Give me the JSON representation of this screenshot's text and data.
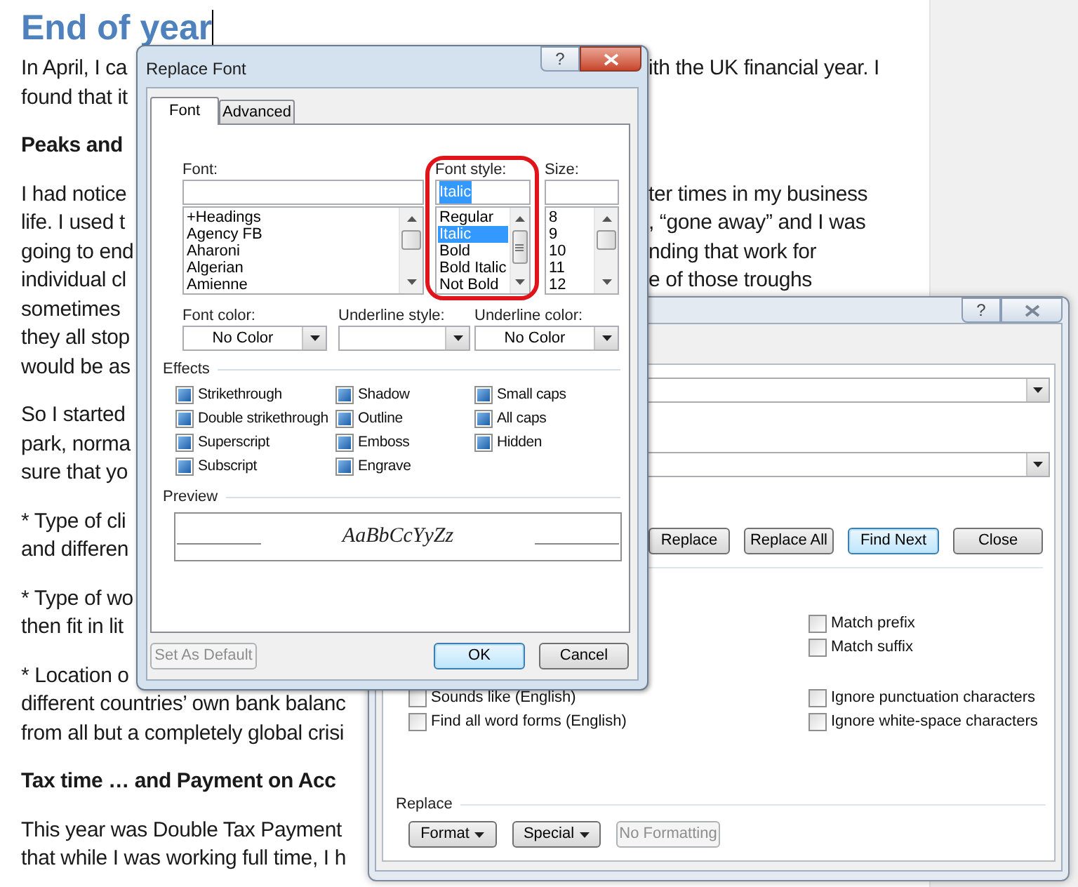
{
  "document": {
    "title": "End of year",
    "paragraphs": [
      {
        "kind": "body",
        "lines": [
          {
            "left": "In April, I ca",
            "right": "ith the UK financial year. I"
          },
          {
            "left": "found that it"
          }
        ]
      },
      {
        "kind": "heading",
        "lines": [
          {
            "left": "Peaks and"
          }
        ]
      },
      {
        "kind": "body",
        "lines": [
          {
            "left": "I had notice",
            "right": "ter times in my business"
          },
          {
            "left": "life. I used t",
            "right": ", “gone away” and I was"
          },
          {
            "left": "going to end",
            "right": "nding that work for"
          },
          {
            "left": "individual cl",
            "right": "e of those troughs"
          },
          {
            "left": "sometimes"
          },
          {
            "left": "they all stop"
          },
          {
            "left": "would be as"
          }
        ]
      },
      {
        "kind": "body",
        "lines": [
          {
            "left": "So I started"
          },
          {
            "left": "park, norma"
          },
          {
            "left": "sure that yo"
          }
        ]
      },
      {
        "kind": "body",
        "lines": [
          {
            "left": "* Type of cli"
          },
          {
            "left": "and differen"
          }
        ]
      },
      {
        "kind": "body",
        "lines": [
          {
            "left": "* Type of wo"
          },
          {
            "left": "then fit in lit"
          }
        ]
      },
      {
        "kind": "body",
        "lines": [
          {
            "left": "* Location o"
          },
          {
            "left": "different countries’ own bank balanc"
          },
          {
            "left": "from all but a completely global crisi"
          }
        ]
      },
      {
        "kind": "heading",
        "lines": [
          {
            "left": "Tax time … and Payment on Acc"
          }
        ]
      },
      {
        "kind": "body",
        "lines": [
          {
            "left": "This year was Double Tax Payment"
          },
          {
            "left": "that while I was working full time, I h"
          }
        ]
      }
    ]
  },
  "find_replace_dialog": {
    "active": false,
    "help": "?",
    "buttons": [
      {
        "label": "Replace",
        "default": false
      },
      {
        "label": "Replace All",
        "default": false
      },
      {
        "label": "Find Next",
        "default": true
      },
      {
        "label": "Close",
        "default": false
      }
    ],
    "options_left": [
      {
        "label": "Sounds like (English)",
        "checked": false
      },
      {
        "label": "Find all word forms (English)",
        "checked": false
      }
    ],
    "options_right": [
      {
        "label": "Match prefix",
        "checked": false
      },
      {
        "label": "Match suffix",
        "checked": false
      },
      {
        "label": "Ignore punctuation characters",
        "checked": false
      },
      {
        "label": "Ignore white-space characters",
        "checked": false
      }
    ],
    "replace_section": {
      "label": "Replace",
      "buttons": [
        {
          "label": "Format",
          "menu": true,
          "disabled": false
        },
        {
          "label": "Special",
          "menu": true,
          "disabled": false
        },
        {
          "label": "No Formatting",
          "menu": false,
          "disabled": true
        }
      ]
    }
  },
  "replace_font_dialog": {
    "title": "Replace Font",
    "active": true,
    "help": "?",
    "tabs": [
      {
        "label": "Font",
        "selected": true
      },
      {
        "label": "Advanced",
        "selected": false
      }
    ],
    "pickers": [
      {
        "label": "Font:",
        "items": [
          {
            "label": "+Headings",
            "selected": false
          },
          {
            "label": "Agency FB",
            "selected": false
          },
          {
            "label": "Aharoni",
            "selected": false
          },
          {
            "label": "Algerian",
            "selected": false
          },
          {
            "label": "Amienne",
            "selected": false
          }
        ]
      },
      {
        "label": "Font style:",
        "value": "Italic",
        "value_selected": true,
        "items": [
          {
            "label": "Regular",
            "selected": false
          },
          {
            "label": "Italic",
            "selected": true
          },
          {
            "label": "Bold",
            "selected": false
          },
          {
            "label": "Bold Italic",
            "selected": false
          },
          {
            "label": "Not Bold",
            "selected": false
          }
        ]
      },
      {
        "label": "Size:",
        "items": [
          {
            "label": "8",
            "selected": false
          },
          {
            "label": "9",
            "selected": false
          },
          {
            "label": "10",
            "selected": false
          },
          {
            "label": "11",
            "selected": false
          },
          {
            "label": "12",
            "selected": false
          }
        ]
      }
    ],
    "dropdowns": [
      {
        "label": "Font color:",
        "value": "No Color"
      },
      {
        "label": "Underline style:"
      },
      {
        "label": "Underline color:",
        "value": "No Color"
      }
    ],
    "effects": {
      "label": "Effects",
      "options": [
        {
          "label": "Strikethrough",
          "indeterminate": true
        },
        {
          "label": "Double strikethrough",
          "indeterminate": true
        },
        {
          "label": "Superscript",
          "indeterminate": true
        },
        {
          "label": "Subscript",
          "indeterminate": true
        },
        {
          "label": "Shadow",
          "indeterminate": true
        },
        {
          "label": "Outline",
          "indeterminate": true
        },
        {
          "label": "Emboss",
          "indeterminate": true
        },
        {
          "label": "Engrave",
          "indeterminate": true
        },
        {
          "label": "Small caps",
          "indeterminate": true
        },
        {
          "label": "All caps",
          "indeterminate": true
        },
        {
          "label": "Hidden",
          "indeterminate": true
        }
      ]
    },
    "preview": {
      "label": "Preview",
      "sample": "AaBbCcYyZz"
    },
    "buttons": [
      {
        "label": "Set As Default",
        "disabled": true
      },
      {
        "label": "OK",
        "disabled": false,
        "default": true
      },
      {
        "label": "Cancel",
        "disabled": false,
        "default": false
      }
    ]
  }
}
